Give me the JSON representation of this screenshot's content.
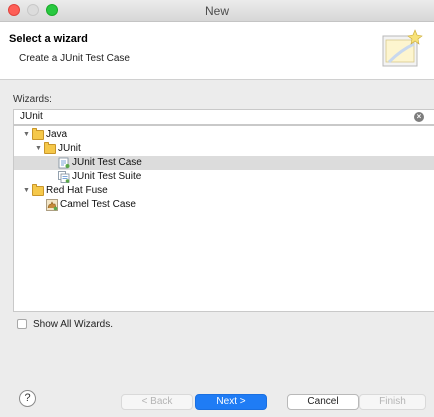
{
  "window": {
    "title": "New"
  },
  "header": {
    "title": "Select a wizard",
    "description": "Create a JUnit Test Case",
    "banner_icon": "new-wizard-icon"
  },
  "wizards": {
    "label": "Wizards:",
    "filter_value": "JUnit",
    "clear_icon": "clear-icon"
  },
  "tree": {
    "items": [
      {
        "label": "Java",
        "depth": 0,
        "expanded": true,
        "icon": "folder-icon",
        "selected": false
      },
      {
        "label": "JUnit",
        "depth": 1,
        "expanded": true,
        "icon": "folder-icon",
        "selected": false
      },
      {
        "label": "JUnit Test Case",
        "depth": 2,
        "expanded": null,
        "icon": "junit-test-case-icon",
        "selected": true
      },
      {
        "label": "JUnit Test Suite",
        "depth": 2,
        "expanded": null,
        "icon": "junit-test-suite-icon",
        "selected": false
      },
      {
        "label": "Red Hat Fuse",
        "depth": 0,
        "expanded": true,
        "icon": "folder-icon",
        "selected": false
      },
      {
        "label": "Camel Test Case",
        "depth": 1,
        "expanded": null,
        "icon": "camel-test-case-icon",
        "selected": false
      }
    ]
  },
  "show_all": {
    "label": "Show All Wizards.",
    "checked": false
  },
  "buttons": {
    "help": "?",
    "back": "< Back",
    "next": "Next >",
    "cancel": "Cancel",
    "finish": "Finish"
  },
  "colors": {
    "accent": "#1f7cf5",
    "selection": "#dcdcdc"
  }
}
